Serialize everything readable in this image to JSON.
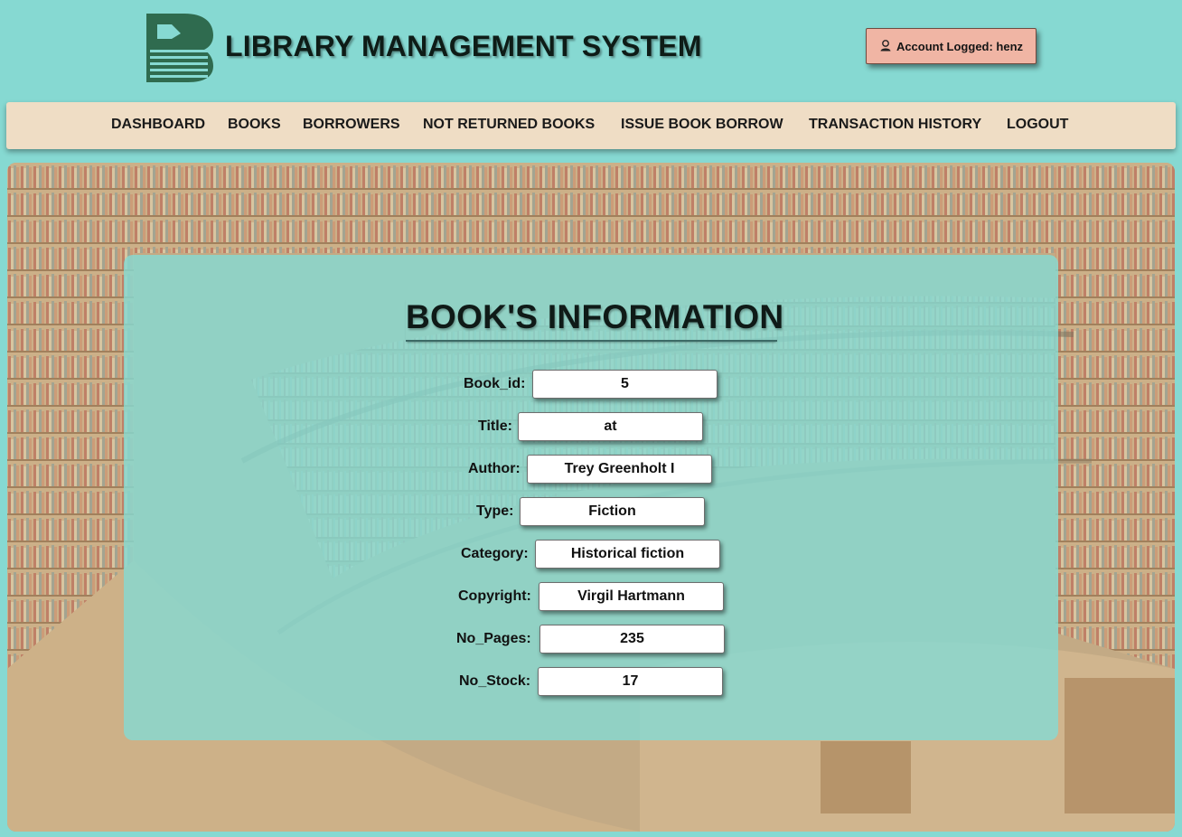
{
  "header": {
    "title": "LIBRARY MANAGEMENT SYSTEM",
    "account_label": "Account Logged: henz"
  },
  "nav": {
    "items": [
      {
        "label": "DASHBOARD"
      },
      {
        "label": "BOOKS"
      },
      {
        "label": "BORROWERS"
      },
      {
        "label": "NOT RETURNED BOOKS"
      },
      {
        "label": "ISSUE BOOK BORROW"
      },
      {
        "label": "TRANSACTION HISTORY"
      },
      {
        "label": "LOGOUT"
      }
    ]
  },
  "book": {
    "title": "BOOK'S INFORMATION",
    "fields": [
      {
        "label": "Book_id:",
        "value": "5"
      },
      {
        "label": "Title:",
        "value": "at"
      },
      {
        "label": "Author:",
        "value": "Trey Greenholt I"
      },
      {
        "label": "Type:",
        "value": "Fiction"
      },
      {
        "label": "Category:",
        "value": "Historical fiction"
      },
      {
        "label": "Copyright:",
        "value": "Virgil Hartmann"
      },
      {
        "label": "No_Pages:",
        "value": "235"
      },
      {
        "label": "No_Stock:",
        "value": "17"
      }
    ]
  },
  "colors": {
    "page_bg": "#86d9d2",
    "navbar_bg": "#efddc5",
    "account_badge_bg": "#f0b5a4",
    "logo_green": "#2f6b4f"
  },
  "icons": {
    "logo": "library-logo-icon",
    "account": "user-icon"
  }
}
